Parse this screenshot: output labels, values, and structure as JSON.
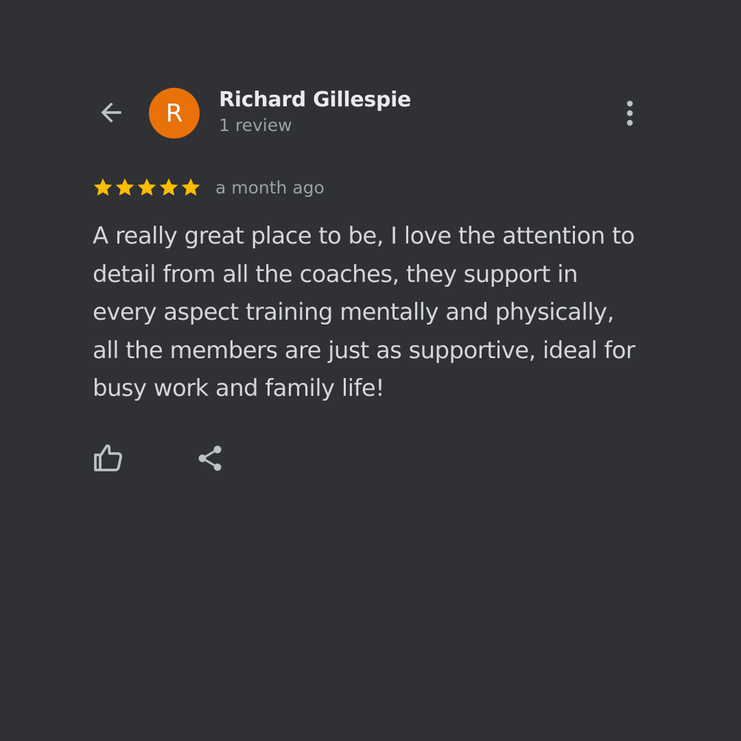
{
  "header": {
    "back_icon": "arrow-back-icon",
    "avatar_initial": "R",
    "avatar_color": "#e8710a",
    "reviewer_name": "Richard Gillespie",
    "review_count": "1 review",
    "more_icon": "more-vert-icon"
  },
  "review": {
    "rating": 5,
    "max_rating": 5,
    "star_color": "#fbbc04",
    "time_ago": "a month ago",
    "text": "A really great place to be, I love the attention to detail from all the coaches, they support in every aspect training mentally and physically, all the members are just as supportive, ideal for busy work and family life!"
  },
  "actions": {
    "like_icon": "thumb-up-icon",
    "share_icon": "share-icon"
  },
  "colors": {
    "background": "#303134",
    "primary_text": "#e8eaed",
    "secondary_text": "#9aa0a6",
    "icon": "#bdc1c6"
  }
}
